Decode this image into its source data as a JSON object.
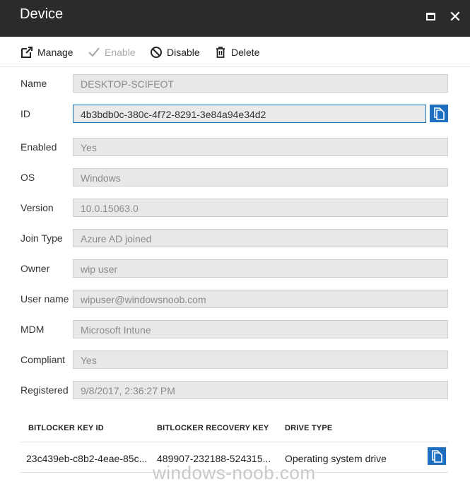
{
  "window": {
    "title": "Device"
  },
  "toolbar": {
    "manage_label": "Manage",
    "enable_label": "Enable",
    "disable_label": "Disable",
    "delete_label": "Delete"
  },
  "fields": {
    "name": {
      "label": "Name",
      "value": "DESKTOP-SCIFEOT"
    },
    "id": {
      "label": "ID",
      "value": "4b3bdb0c-380c-4f72-8291-3e84a94e34d2"
    },
    "enabled": {
      "label": "Enabled",
      "value": "Yes"
    },
    "os": {
      "label": "OS",
      "value": "Windows"
    },
    "version": {
      "label": "Version",
      "value": "10.0.15063.0"
    },
    "join_type": {
      "label": "Join Type",
      "value": "Azure AD joined"
    },
    "owner": {
      "label": "Owner",
      "value": "wip user"
    },
    "user_name": {
      "label": "User name",
      "value": "wipuser@windowsnoob.com"
    },
    "mdm": {
      "label": "MDM",
      "value": "Microsoft Intune"
    },
    "compliant": {
      "label": "Compliant",
      "value": "Yes"
    },
    "registered": {
      "label": "Registered",
      "value": "9/8/2017, 2:36:27 PM"
    }
  },
  "bitlocker_table": {
    "columns": [
      "BITLOCKER KEY ID",
      "BITLOCKER RECOVERY KEY",
      "DRIVE TYPE"
    ],
    "rows": [
      {
        "key_id": "23c439eb-c8b2-4eae-85c...",
        "recovery_key": "489907-232188-524315...",
        "drive_type": "Operating system drive"
      }
    ]
  },
  "watermark": "windows-noob.com",
  "colors": {
    "titlebar": "#2b2b2b",
    "accent": "#1f6fc1"
  }
}
